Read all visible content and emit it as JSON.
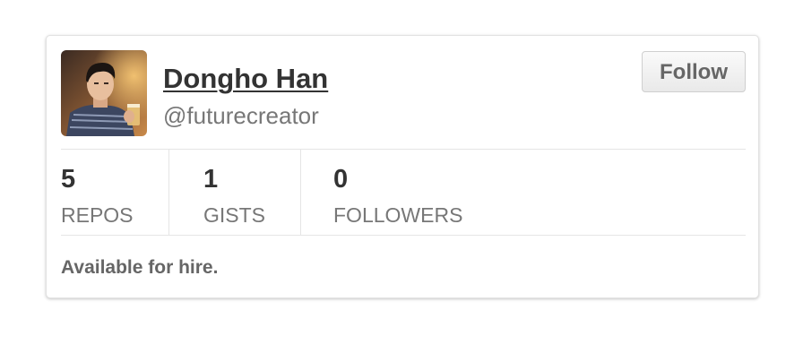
{
  "profile": {
    "avatar_alt": "Dongho Han",
    "name": "Dongho Han",
    "handle": "@futurecreator"
  },
  "actions": {
    "follow_label": "Follow"
  },
  "stats": [
    {
      "count": "5",
      "label": "REPOS"
    },
    {
      "count": "1",
      "label": "GISTS"
    },
    {
      "count": "0",
      "label": "FOLLOWERS"
    }
  ],
  "footer": {
    "hire_text": "Available for hire."
  },
  "colors": {
    "name": "#333333",
    "muted": "#777777",
    "border": "#e1e1e1",
    "button_text": "#666666"
  }
}
